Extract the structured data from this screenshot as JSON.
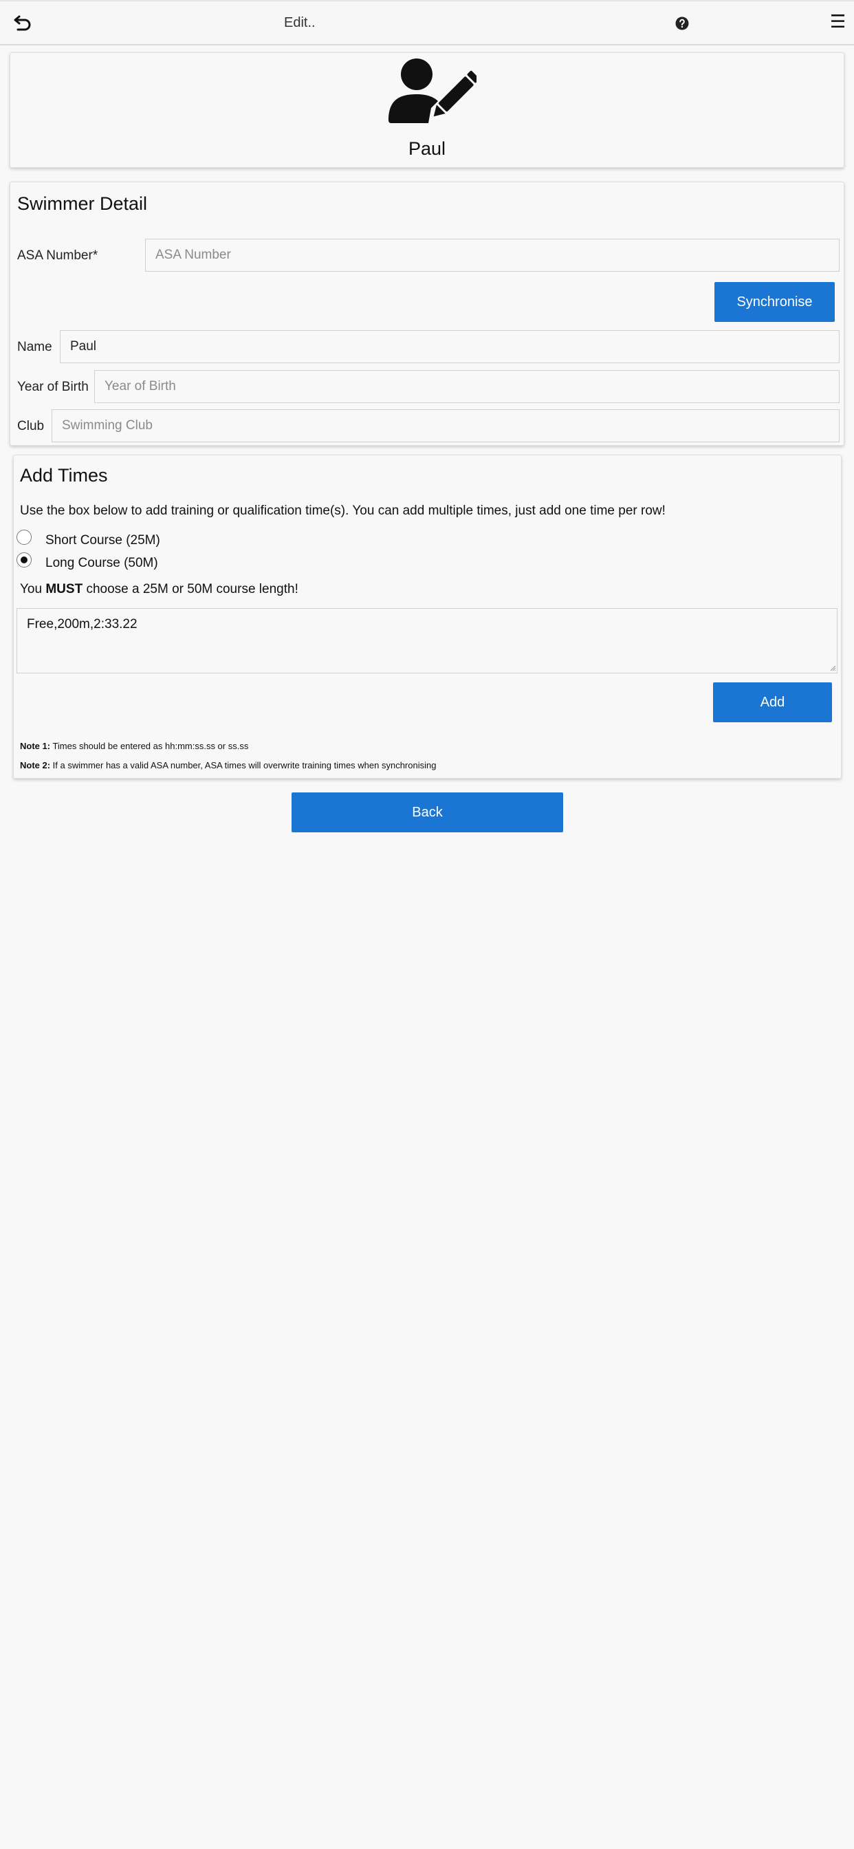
{
  "header": {
    "title": "Edit..",
    "back_icon": "return-arrow-icon",
    "help_icon": "question-circle-icon",
    "menu_icon": "hamburger-menu-icon",
    "menu_glyph": "☰"
  },
  "profile": {
    "avatar_icon": "user-edit-icon",
    "name": "Paul"
  },
  "swimmer_detail": {
    "title": "Swimmer Detail",
    "asa_label": "ASA Number*",
    "asa_placeholder": "ASA Number",
    "asa_value": "",
    "sync_label": "Synchronise",
    "name_label": "Name",
    "name_value": "Paul",
    "yob_label": "Year of Birth",
    "yob_placeholder": "Year of Birth",
    "club_label": "Club",
    "club_placeholder": "Swimming Club"
  },
  "add_times": {
    "title": "Add Times",
    "instructions": "Use the box below to add training or qualification time(s). You can add multiple times, just add one time per row!",
    "options": [
      {
        "label": "Short Course (25M)",
        "checked": false
      },
      {
        "label": "Long Course (50M)",
        "checked": true
      }
    ],
    "must_prefix": "You ",
    "must_word": "MUST",
    "must_suffix": " choose a 25M or 50M course length!",
    "textarea_value": "Free,200m,2:33.22",
    "add_label": "Add",
    "note1_label": "Note 1:",
    "note1_text": " Times should be entered as hh:mm:ss.ss or ss.ss",
    "note2_label": "Note 2:",
    "note2_text": " If a swimmer has a valid ASA number, ASA times will overwrite training times when synchronising"
  },
  "footer": {
    "back_label": "Back"
  },
  "colors": {
    "accent": "#1b76d3",
    "background": "#f8f8f8"
  }
}
